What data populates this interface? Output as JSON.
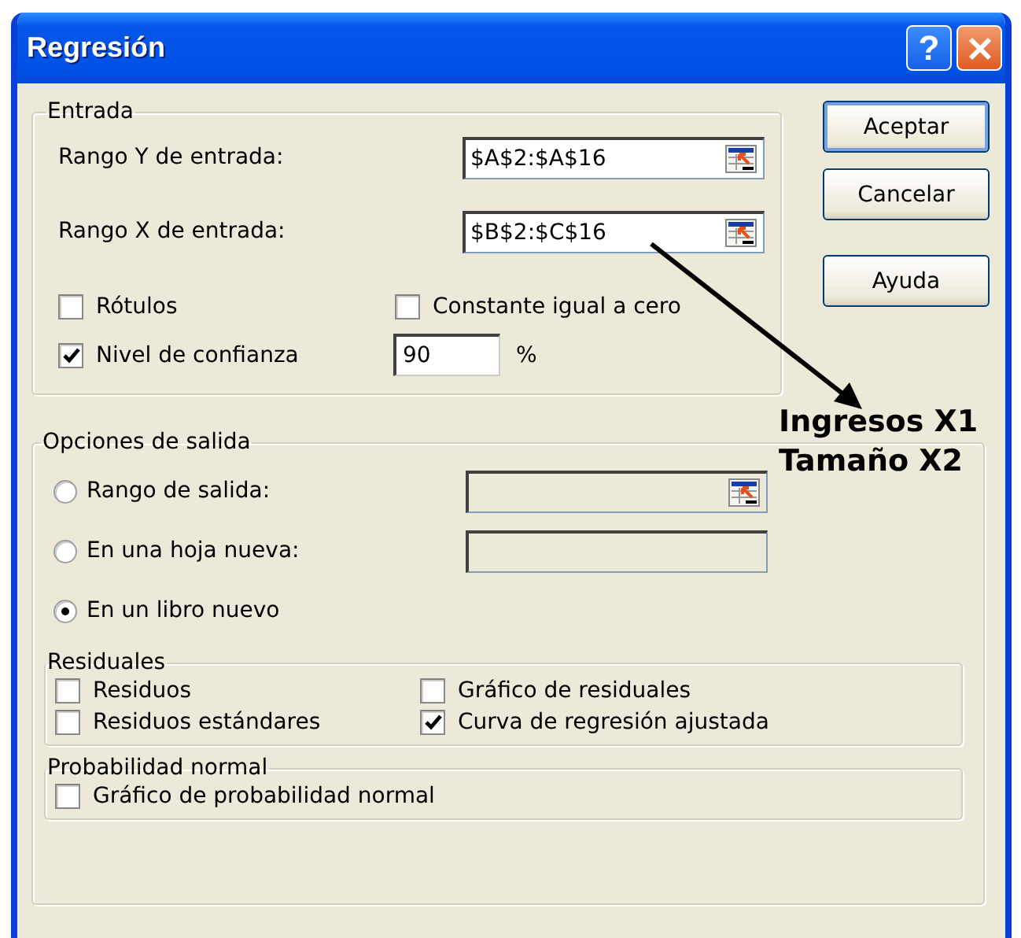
{
  "window": {
    "title": "Regresión",
    "title_buttons": [
      {
        "kind": "help",
        "label": "?"
      },
      {
        "kind": "close"
      }
    ]
  },
  "entrada": {
    "legend": "Entrada",
    "ranges": [
      {
        "label": "Rango Y de entrada:",
        "value": "$A$2:$A$16"
      },
      {
        "label": "Rango X de entrada:",
        "value": "$B$2:$C$16"
      }
    ],
    "checkboxes": [
      {
        "label": "Rótulos",
        "checked": false
      },
      {
        "label": "Constante igual a cero",
        "checked": false
      }
    ],
    "confidence": {
      "label": "Nivel de confianza",
      "checked": true,
      "value": "90",
      "unit": "%"
    }
  },
  "buttons": [
    {
      "label": "Aceptar",
      "default": true
    },
    {
      "label": "Cancelar",
      "default": false
    },
    {
      "label": "Ayuda",
      "default": false
    }
  ],
  "salida": {
    "legend": "Opciones de salida",
    "options": [
      {
        "label": "Rango de salida:",
        "selected": false,
        "kind": "range"
      },
      {
        "label": "En una hoja nueva:",
        "selected": false,
        "kind": "text"
      },
      {
        "label": "En un libro nuevo",
        "selected": true,
        "kind": "plain"
      }
    ],
    "groups": [
      {
        "legend": "Residuales",
        "checkboxes": [
          {
            "label": "Residuos",
            "checked": false
          },
          {
            "label": "Gráfico de residuales",
            "checked": false
          },
          {
            "label": "Residuos estándares",
            "checked": false
          },
          {
            "label": "Curva de regresión ajustada",
            "checked": true
          }
        ]
      },
      {
        "legend": "Probabilidad normal",
        "checkboxes": [
          {
            "label": "Gráfico de probabilidad normal",
            "checked": false
          }
        ]
      }
    ]
  },
  "annotation": {
    "lines": [
      "Ingresos X1",
      "Tamaño X2"
    ]
  }
}
